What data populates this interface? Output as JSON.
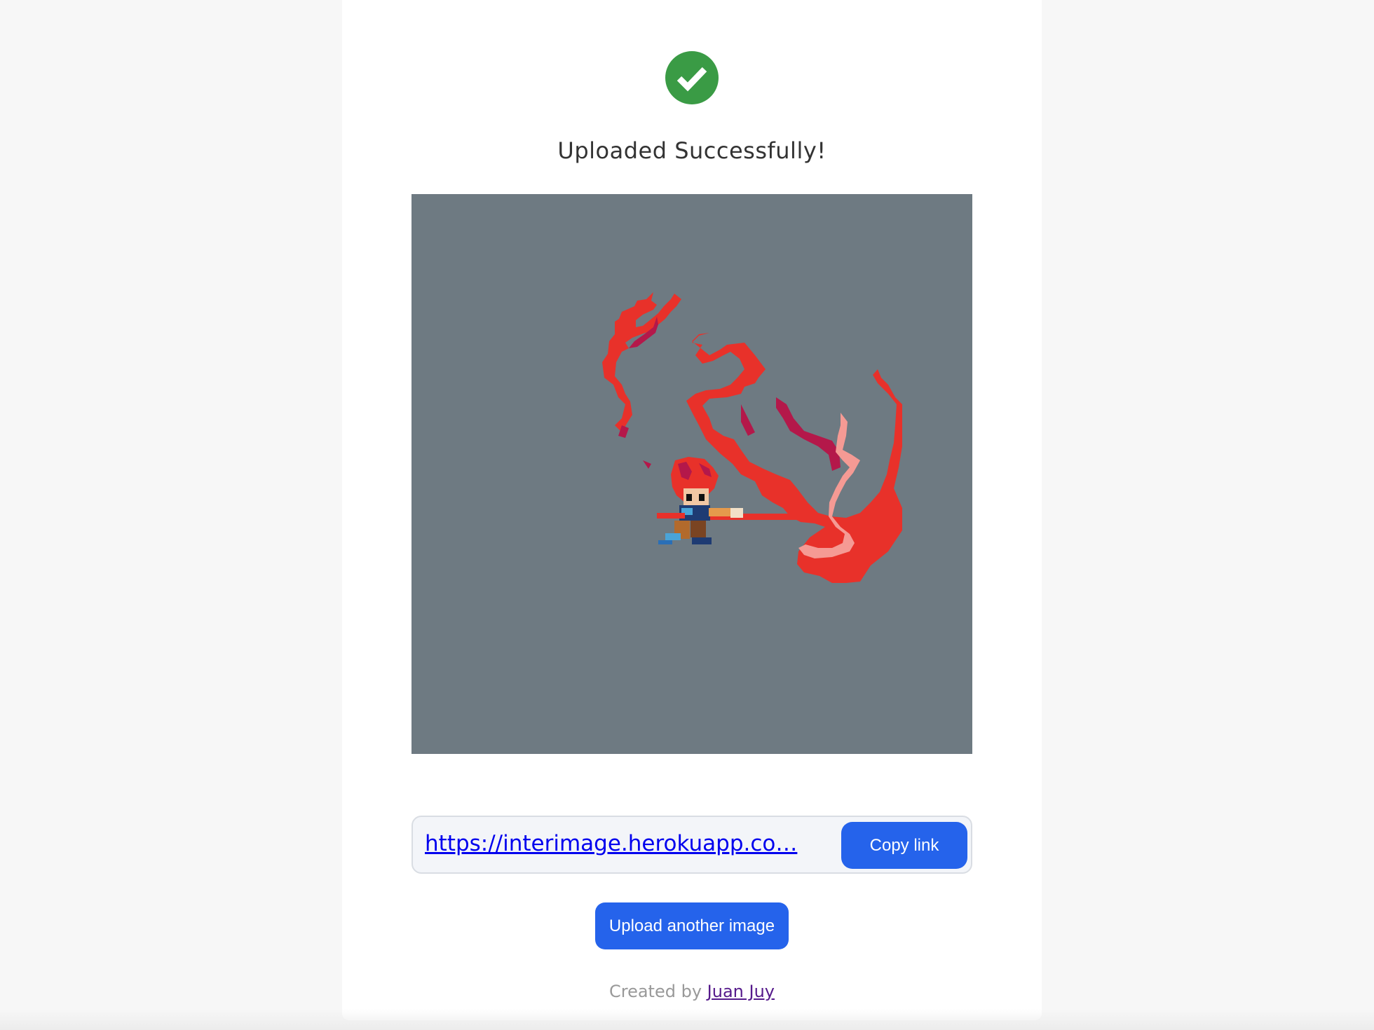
{
  "status": {
    "icon": "check-circle-icon",
    "title": "Uploaded Successfully!",
    "color": "#3a9b45"
  },
  "preview": {
    "background": "#6e7a82"
  },
  "share": {
    "link_text": "https://interimage.herokuapp.co…",
    "copy_label": "Copy link"
  },
  "actions": {
    "upload_another_label": "Upload another image",
    "accent": "#2563eb"
  },
  "footer": {
    "prefix": "Created by",
    "author": "Juan Juy"
  }
}
